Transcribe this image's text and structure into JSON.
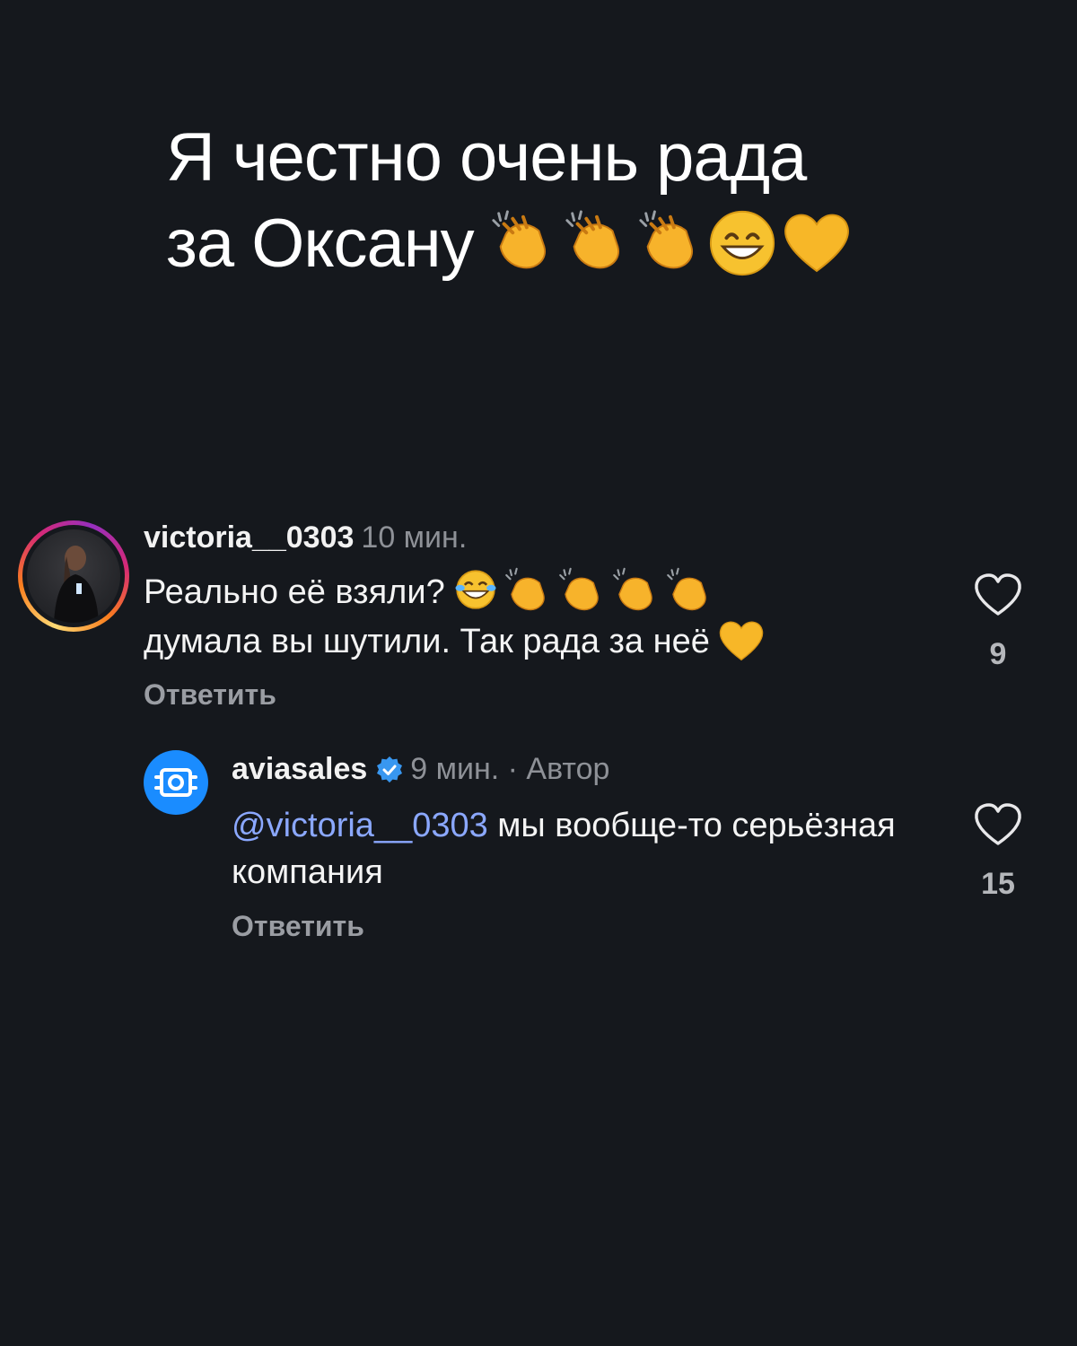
{
  "headline": {
    "line1": "Я честно очень рада",
    "line2": "за Оксану"
  },
  "comments": [
    {
      "username": "victoria__0303",
      "time": "10 мин.",
      "text_line1": "Реально её взяли?",
      "text_line2": "думала вы шутили. Так рада за неё",
      "reply_label": "Ответить",
      "likes": "9"
    },
    {
      "username": "aviasales",
      "time": "9 мин. · Автор",
      "mention": "@victoria__0303",
      "text_rest": " мы вообще-то серьёзная компания",
      "reply_label": "Ответить",
      "likes": "15",
      "verified": true
    }
  ],
  "colors": {
    "background": "#15181d",
    "mention": "#8ba8ff",
    "brand_avatar": "#1a8cff",
    "verified": "#3897f0"
  },
  "icons": [
    "clap-icon",
    "grin-icon",
    "yellow-heart-icon",
    "laugh-cry-icon",
    "heart-outline-icon",
    "verified-badge-icon"
  ]
}
